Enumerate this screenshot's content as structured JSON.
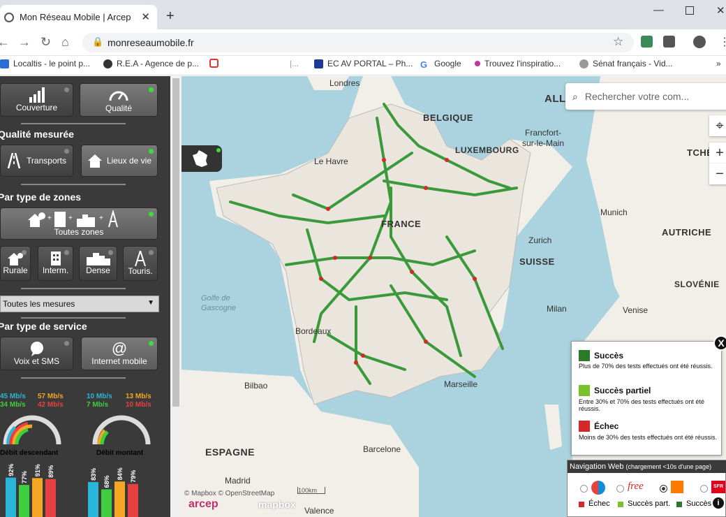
{
  "browser": {
    "tab_title": "Mon Réseau Mobile | Arcep",
    "url": "monreseaumobile.fr",
    "bookmarks": [
      "Localtis - le point p...",
      "R.E.A - Agence de p...",
      "EC AV PORTAL – Ph...",
      "Google",
      "Trouvez l'inspiratio...",
      "Sénat français - Vid..."
    ]
  },
  "sidebar": {
    "top_buttons": [
      {
        "label": "Couverture"
      },
      {
        "label": "Qualité"
      }
    ],
    "quality_title": "Qualité mesurée",
    "quality_buttons": [
      {
        "label": "Transports"
      },
      {
        "label": "Lieux de vie"
      }
    ],
    "zones_title": "Par type de zones",
    "all_zones": "Toutes zones",
    "zones": [
      {
        "label": "Rurale"
      },
      {
        "label": "Interm."
      },
      {
        "label": "Dense"
      },
      {
        "label": "Touris."
      }
    ],
    "measures_select": "Toutes les mesures",
    "service_title": "Par type de service",
    "service_buttons": [
      {
        "label": "Voix et SMS"
      },
      {
        "label": "Internet mobile"
      }
    ],
    "download": {
      "label": "Débit descendant",
      "speeds": [
        {
          "text": "45 Mb/s",
          "color": "#29b6d8"
        },
        {
          "text": "57 Mb/s",
          "color": "#f5a623"
        },
        {
          "text": "34 Mb/s",
          "color": "#3ecf3e"
        },
        {
          "text": "42 Mb/s",
          "color": "#e84040"
        }
      ]
    },
    "upload": {
      "label": "Débit montant",
      "speeds": [
        {
          "text": "10 Mb/s",
          "color": "#29b6d8"
        },
        {
          "text": "13 Mb/s",
          "color": "#f5a623"
        },
        {
          "text": "7 Mb/s",
          "color": "#3ecf3e"
        },
        {
          "text": "10 Mb/s",
          "color": "#e84040"
        }
      ]
    },
    "bars_left": [
      "92%",
      "77%",
      "91%",
      "89%"
    ],
    "bars_right": [
      "83%",
      "68%",
      "84%",
      "79%"
    ],
    "bar_colors": [
      "#29b6d8",
      "#3ecf3e",
      "#f5a623",
      "#e84040"
    ],
    "bars_left_values": [
      92,
      77,
      91,
      89
    ],
    "bars_right_values": [
      83,
      68,
      84,
      79
    ]
  },
  "map": {
    "search_placeholder": "Rechercher votre com...",
    "labels": {
      "londres": "Londres",
      "belgique": "BELGIQUE",
      "all": "ALL",
      "francfort": "Francfort-",
      "sur_le_main": "sur-le-Main",
      "luxembourg": "LUXEMBOURG",
      "tche": "TCHÈ",
      "le_havre": "Le Havre",
      "munich": "Munich",
      "autriche": "AUTRICHE",
      "france": "FRANCE",
      "zurich": "Zurich",
      "suisse": "SUISSE",
      "slovenie": "SLOVÉNIE",
      "golfe1": "Golfe de",
      "golfe2": "Gascogne",
      "milan": "Milan",
      "venise": "Venise",
      "bordeaux": "Bordeaux",
      "bilbao": "Bilbao",
      "marseille": "Marseille",
      "espagne": "ESPAGNE",
      "barcelone": "Barcelone",
      "madrid": "Madrid",
      "valence": "Valence"
    },
    "attribution_mapbox": "© Mapbox © OpenStreetMap",
    "scale": "100km",
    "logo_arcep": "arcep",
    "logo_mapbox": "mapbox"
  },
  "legend": {
    "items": [
      {
        "title": "Succès",
        "desc": "Plus de 70% des tests effectués ont été réussis.",
        "color": "#2a7a2a"
      },
      {
        "title": "Succès partiel",
        "desc": "Entre 30% et 70% des tests effectués ont été réussis.",
        "color": "#7ac22a"
      },
      {
        "title": "Échec",
        "desc": "Moins de 30% des tests effectués ont été réussis.",
        "color": "#d62828"
      }
    ],
    "close": "X"
  },
  "nav_web": {
    "title": "Navigation Web",
    "subtitle": "(chargement <10s d'une page)",
    "free_label": "free",
    "sfr_label": "SFR",
    "legend": [
      {
        "label": "Échec",
        "color": "#d62828"
      },
      {
        "label": "Succès part.",
        "color": "#7ac22a"
      },
      {
        "label": "Succès",
        "color": "#2a7a2a"
      }
    ]
  }
}
